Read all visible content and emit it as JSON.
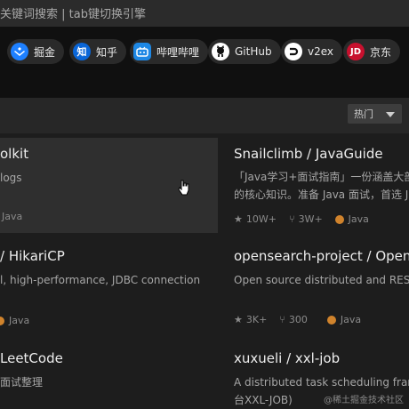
{
  "search": {
    "hint": "关键词搜索 | tab键切换引擎"
  },
  "sites": [
    {
      "label": "掘金",
      "icon": "juejin-icon",
      "color": "#1e80ff"
    },
    {
      "label": "知乎",
      "icon": "zhihu-icon",
      "color": "#0a66d8"
    },
    {
      "label": "哔哩哔哩",
      "icon": "bilibili-icon",
      "color": "#1e88e5"
    },
    {
      "label": "GitHub",
      "icon": "github-icon",
      "color": "#ffffff"
    },
    {
      "label": "v2ex",
      "icon": "v2ex-icon",
      "color": "#ffffff"
    },
    {
      "label": "京东",
      "icon": "jd-icon",
      "color": "#c8102e"
    }
  ],
  "sort": {
    "label": "热门"
  },
  "cards": [
    {
      "title": "olkit",
      "desc1": "logs",
      "desc2": "",
      "stars": "",
      "forks": "",
      "lang": "Java"
    },
    {
      "title": "Snailclimb / JavaGuide",
      "desc1": "「Java学习+面试指南」一份涵盖大部",
      "desc2": "的核心知识。准备 Java 面试，首选 J",
      "stars": "10W+",
      "forks": "3W+",
      "lang": "Java"
    },
    {
      "title": "/ HikariCP",
      "desc1": "l, high-performance, JDBC connection",
      "desc2": "",
      "stars": "",
      "forks": "",
      "lang": "Java"
    },
    {
      "title": "opensearch-project / OpenS",
      "desc1": "Open source distributed and REST",
      "desc2": "",
      "stars": "3K+",
      "forks": "300",
      "lang": "Java"
    },
    {
      "title": "LeetCode",
      "desc1": "面试整理",
      "desc2": "",
      "stars": "",
      "forks": "",
      "lang": ""
    },
    {
      "title": "xuxueli / xxl-job",
      "desc1": "A distributed task scheduling frame",
      "desc2": "台XXL-JOB)",
      "stars": "",
      "forks": "",
      "lang": ""
    }
  ],
  "watermark": "@稀土掘金技术社区"
}
